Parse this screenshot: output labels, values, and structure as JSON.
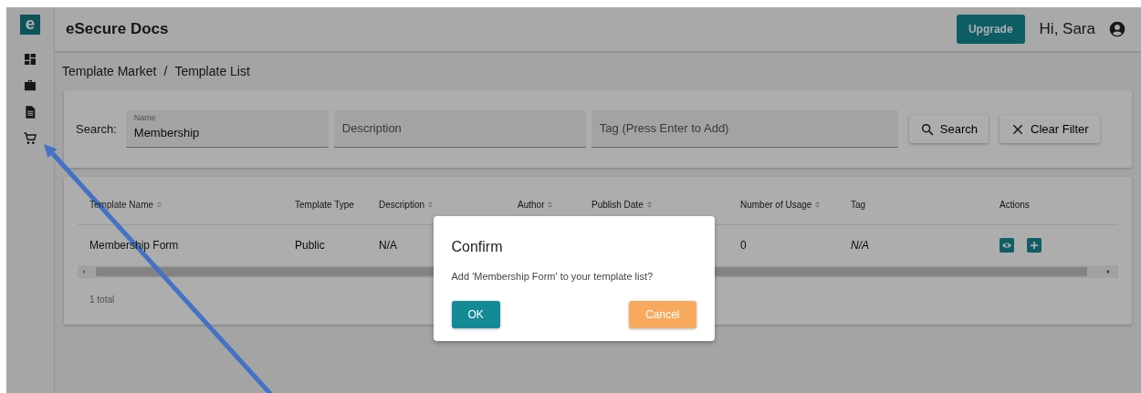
{
  "app": {
    "logo": "e",
    "title": "eSecure Docs"
  },
  "header": {
    "upgrade": "Upgrade",
    "greeting": "Hi, Sara"
  },
  "breadcrumb": {
    "items": [
      "Template Market",
      "Template List"
    ],
    "separator": "/"
  },
  "search": {
    "label": "Search:",
    "fields": [
      {
        "label": "Name",
        "value": "Membership"
      },
      {
        "placeholder": "Description"
      },
      {
        "placeholder": "Tag (Press Enter to Add)"
      }
    ],
    "buttons": [
      {
        "kind": "search",
        "label": "Search"
      },
      {
        "kind": "clear",
        "label": "Clear Filter"
      }
    ]
  },
  "table": {
    "columns": [
      {
        "label": "Template Name",
        "sortable": true
      },
      {
        "label": "Template Type",
        "sortable": false
      },
      {
        "label": "Description",
        "sortable": true
      },
      {
        "label": "Author",
        "sortable": true
      },
      {
        "label": "Publish Date",
        "sortable": true
      },
      {
        "label": "Number of Usage",
        "sortable": true
      },
      {
        "label": "Tag",
        "sortable": false
      },
      {
        "label": "Actions",
        "sortable": false
      }
    ],
    "rows": [
      {
        "template_name": "Membership Form",
        "template_type": "Public",
        "description": "N/A",
        "number_of_usage": "0",
        "tag": "N/A"
      }
    ],
    "footer": "1 total"
  },
  "dialog": {
    "title": "Confirm",
    "message": "Add 'Membership Form' to your template list?",
    "buttons": [
      {
        "kind": "primary",
        "label": "OK"
      },
      {
        "kind": "warning",
        "label": "Cancel"
      }
    ]
  }
}
